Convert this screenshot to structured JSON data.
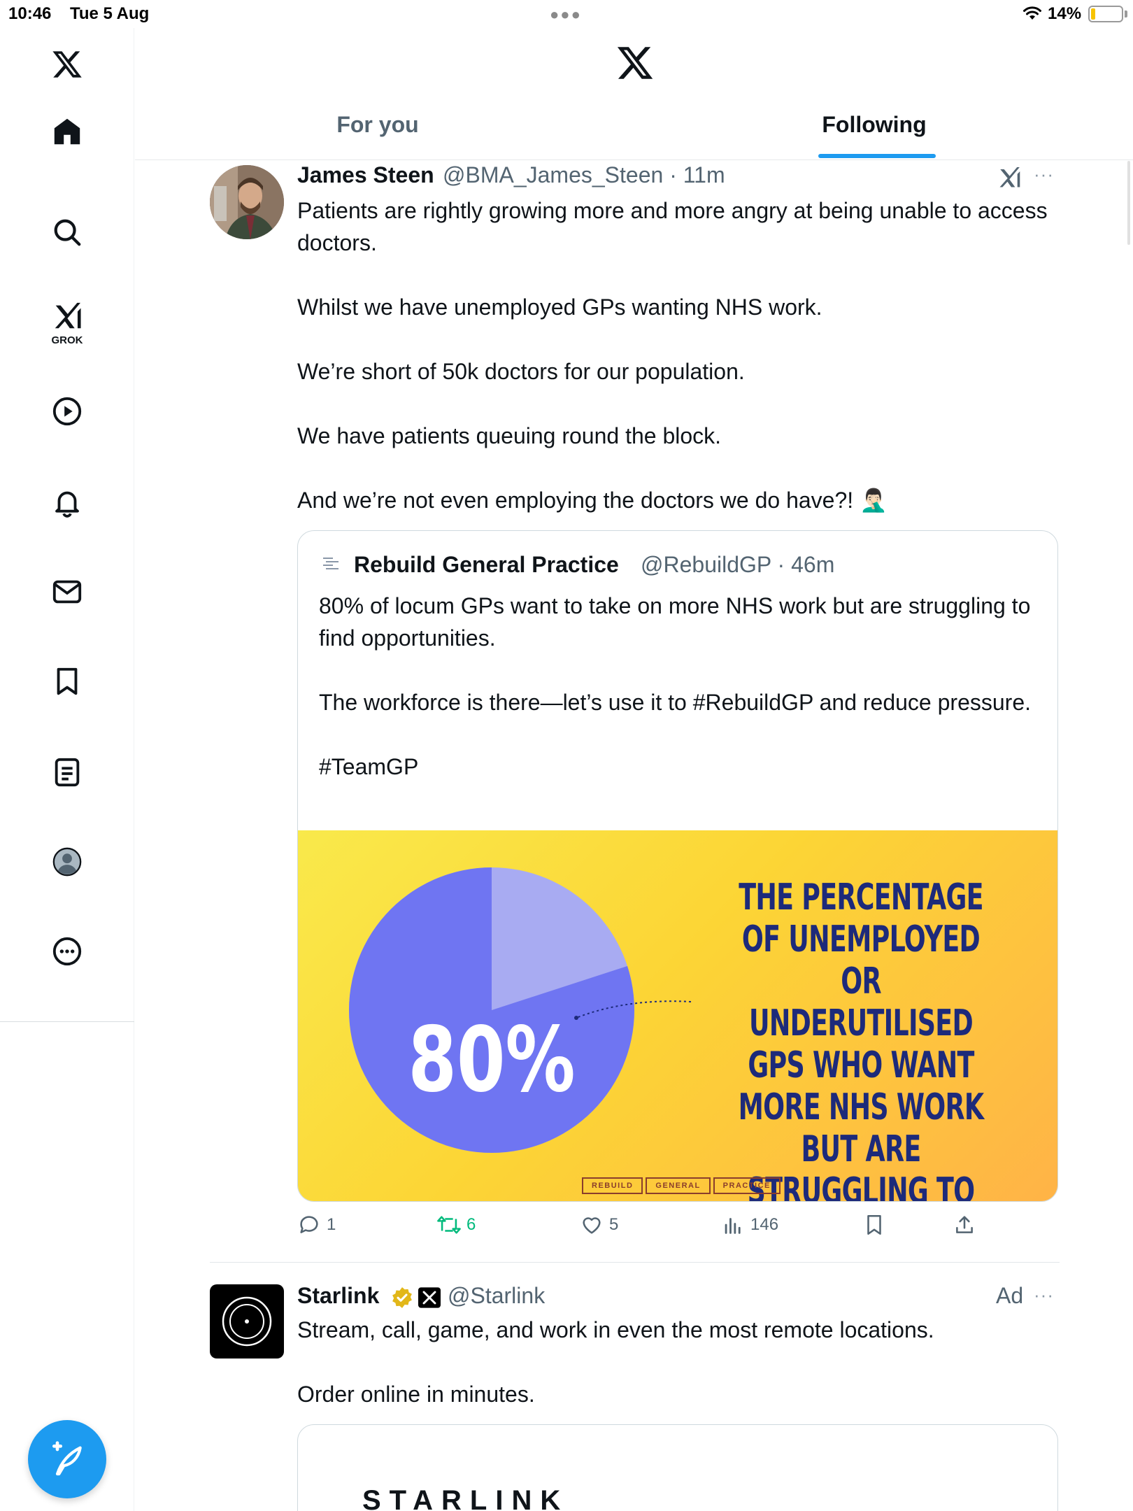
{
  "status_bar": {
    "time": "10:46",
    "date": "Tue 5 Aug",
    "battery": "14%",
    "battery_level": 0.14
  },
  "sidebar": {
    "grok_label": "GROK",
    "items": [
      "home-icon",
      "search-icon",
      "grok-icon",
      "video-icon",
      "notifications-icon",
      "messages-icon",
      "bookmarks-icon",
      "lists-icon",
      "profile-icon",
      "more-icon"
    ]
  },
  "header": {
    "tabs": [
      {
        "label": "For you",
        "active": false
      },
      {
        "label": "Following",
        "active": true
      }
    ],
    "accent_color": "#1d9bf0"
  },
  "tweet": {
    "author_name": "James Steen",
    "handle_time": "@BMA_James_Steen · 11m",
    "body": "Patients are rightly growing more and more angry at being unable to access doctors.\n\nWhilst we have unemployed GPs wanting NHS work.\n\nWe’re short of 50k doctors for our population.\n\nWe have patients queuing round the block.\n\nAnd we’re not even employing the doctors we do have?! 🤦🏻‍♂️",
    "more": "···",
    "quote": {
      "author_name": "Rebuild General Practice",
      "handle_time": "@RebuildGP · 46m",
      "body": "80% of locum GPs want to take on more NHS work but are struggling to find opportunities.\n\nThe workforce is there—let’s use it to #RebuildGP and reduce pressure.\n\n#TeamGP",
      "image": {
        "percent_label": "80%",
        "percent_value": 80,
        "caption": "THE PERCENTAGE OF UNEMPLOYED OR UNDERUTILISED GPS WHO WANT MORE NHS WORK BUT ARE STRUGGLING TO FIND IT",
        "logo_words": [
          "REBUILD",
          "GENERAL",
          "PRACTICE"
        ],
        "pie_main_color": "#6f75f2",
        "pie_rest_color": "#a8abf2"
      }
    },
    "actions": {
      "replies": "1",
      "reposts": "6",
      "likes": "5",
      "views": "146"
    }
  },
  "ad_tweet": {
    "author_name": "Starlink",
    "handle": "@Starlink",
    "ad_label": "Ad",
    "more": "···",
    "body": "Stream, call, game, and work in even the most remote locations.\n\nOrder online in minutes.",
    "card_logo": "STARLINK"
  }
}
